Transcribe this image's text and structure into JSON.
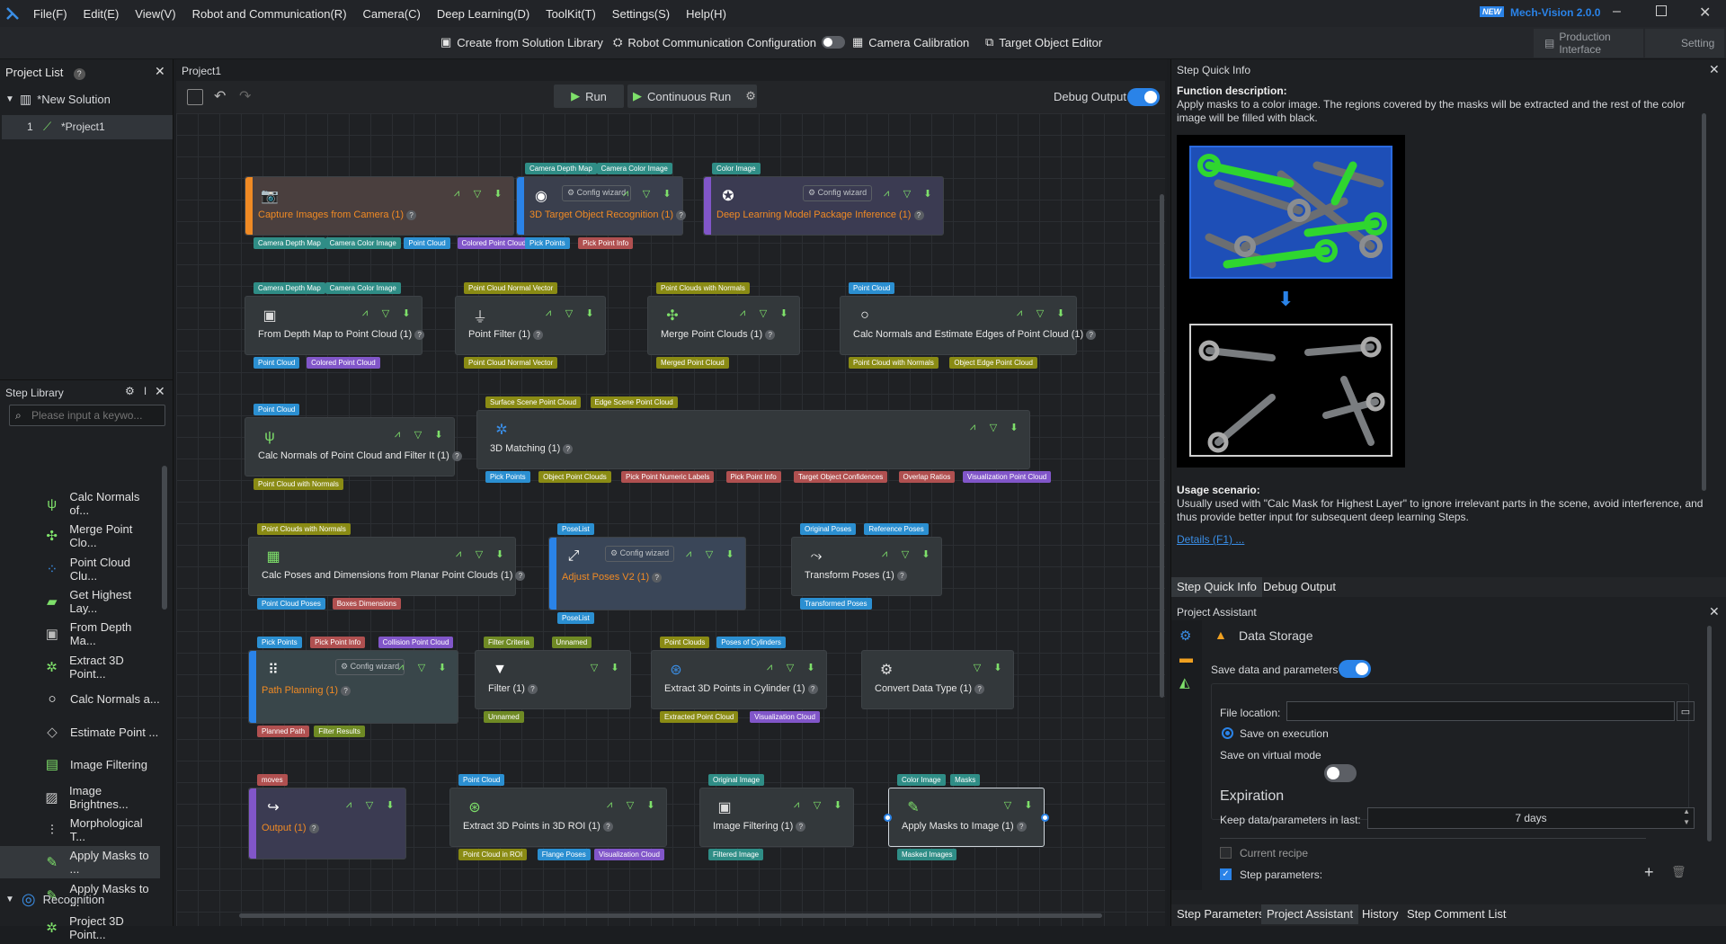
{
  "menu": [
    "File(F)",
    "Edit(E)",
    "View(V)",
    "Robot and Communication(R)",
    "Camera(C)",
    "Deep Learning(D)",
    "ToolKit(T)",
    "Settings(S)",
    "Help(H)"
  ],
  "app": {
    "badge": "NEW",
    "title": "Mech-Vision 2.0.0"
  },
  "toolbar": {
    "create": "Create from Solution Library",
    "robot_comm": "Robot Communication Configuration",
    "camera_cal": "Camera Calibration",
    "target_editor": "Target Object Editor",
    "production": "Production Interface",
    "setting": "Setting"
  },
  "project_list": {
    "title": "Project List",
    "solution": "*New Solution",
    "num": "1",
    "project": "*Project1"
  },
  "step_library": {
    "title": "Step Library",
    "search_placeholder": "Please input a keywo...",
    "items": [
      "Calc Normals of...",
      "Merge Point Clo...",
      "Point Cloud Clu...",
      "Get Highest Lay...",
      "From Depth Ma...",
      "Extract 3D Point...",
      "Calc Normals a...",
      "Estimate Point ...",
      "Image Filtering",
      "Image Brightnes...",
      "Morphological T...",
      "Apply Masks to ...",
      "Apply Masks to ...",
      "Project 3D Point..."
    ],
    "group": "Recognition"
  },
  "canvas": {
    "tab": "Project1",
    "run": "Run",
    "continuous_run": "Continuous Run",
    "debug_output": "Debug Output",
    "config_wizard": "Config wizard"
  },
  "nodes": {
    "n1": {
      "title": "Capture Images from Camera (1)",
      "out": [
        "Camera Depth Map",
        "Camera Color Image",
        "Point Cloud",
        "Colored Point Cloud"
      ]
    },
    "n2": {
      "title": "3D Target Object Recognition (1)",
      "in": [
        "Camera Depth Map",
        "Camera Color Image"
      ],
      "out": [
        "Pick Points",
        "Pick Point Info"
      ]
    },
    "n3": {
      "title": "Deep Learning Model Package Inference (1)",
      "in": [
        "Color Image"
      ]
    },
    "n4": {
      "title": "From Depth Map to Point Cloud (1)",
      "in": [
        "Camera Depth Map",
        "Camera Color Image"
      ],
      "out": [
        "Point Cloud",
        "Colored Point Cloud"
      ]
    },
    "n5": {
      "title": "Point Filter (1)",
      "in": [
        "Point Cloud Normal Vector"
      ],
      "out": [
        "Point Cloud Normal Vector"
      ]
    },
    "n6": {
      "title": "Merge Point Clouds (1)",
      "in": [
        "Point Clouds with Normals"
      ],
      "out": [
        "Merged Point Cloud"
      ]
    },
    "n7": {
      "title": "Calc Normals and Estimate Edges of Point Cloud (1)",
      "in": [
        "Point Cloud"
      ],
      "out": [
        "Point Cloud with Normals",
        "Object Edge Point Cloud"
      ]
    },
    "n8": {
      "title": "Calc Normals of Point Cloud and Filter It (1)",
      "in": [
        "Point Cloud"
      ],
      "out": [
        "Point Cloud with Normals"
      ]
    },
    "n9": {
      "title": "3D Matching (1)",
      "in": [
        "Surface Scene Point Cloud",
        "Edge Scene Point Cloud"
      ],
      "out": [
        "Pick Points",
        "Object Point Clouds",
        "Pick Point Numeric Labels",
        "Pick Point Info",
        "Target Object Confidences",
        "Overlap Ratios",
        "Visualization Point Cloud"
      ]
    },
    "n10": {
      "title": "Calc Poses and Dimensions from Planar Point Clouds (1)",
      "in": [
        "Point Clouds with Normals"
      ],
      "out": [
        "Point Cloud Poses",
        "Boxes Dimensions"
      ]
    },
    "n11": {
      "title": "Adjust Poses V2 (1)",
      "in": [
        "PoseList"
      ],
      "out": [
        "PoseList"
      ]
    },
    "n12": {
      "title": "Transform Poses (1)",
      "in": [
        "Original Poses",
        "Reference Poses"
      ],
      "out": [
        "Transformed Poses"
      ]
    },
    "n13": {
      "title": "Path Planning (1)",
      "in": [
        "Pick Points",
        "Pick Point Info",
        "Collision Point Cloud"
      ],
      "out": [
        "Planned Path",
        "Filter Results"
      ]
    },
    "n14": {
      "title": "Filter (1)",
      "in": [
        "Filter Criteria",
        "Unnamed"
      ],
      "out": [
        "Unnamed"
      ]
    },
    "n15": {
      "title": "Extract 3D Points in Cylinder (1)",
      "in": [
        "Point Clouds",
        "Poses of Cylinders"
      ],
      "out": [
        "Extracted Point Cloud",
        "Visualization Cloud"
      ]
    },
    "n16": {
      "title": "Convert Data Type (1)"
    },
    "n17": {
      "title": "Output (1)",
      "in": [
        "moves"
      ]
    },
    "n18": {
      "title": "Extract 3D Points in 3D ROI (1)",
      "in": [
        "Point Cloud"
      ],
      "out": [
        "Point Cloud in ROI",
        "Flange Poses",
        "Visualization Cloud"
      ]
    },
    "n19": {
      "title": "Image Filtering (1)",
      "in": [
        "Original Image"
      ],
      "out": [
        "Filtered Image"
      ]
    },
    "n20": {
      "title": "Apply Masks to Image (1)",
      "in": [
        "Color Image",
        "Masks"
      ],
      "out": [
        "Masked Images"
      ]
    }
  },
  "quick_info": {
    "title": "Step Quick Info",
    "func_label": "Function description:",
    "func_text": "Apply masks to a color image. The regions covered by the masks will be extracted and the rest of the color image will be filled with black.",
    "usage_label": "Usage scenario:",
    "usage_text": "Usually used with \"Calc Mask for Highest Layer\" to ignore irrelevant parts in the scene, avoid interference, and thus provide better input for subsequent deep learning Steps.",
    "details": "Details (F1) ...",
    "tabs": [
      "Step Quick Info",
      "Debug Output"
    ]
  },
  "assistant": {
    "title": "Project Assistant",
    "section": "Data Storage",
    "save_data": "Save data and parameters",
    "file_location": "File location:",
    "save_on_execution": "Save on execution",
    "save_virtual": "Save on virtual mode",
    "expiration": "Expiration",
    "keep_label": "Keep data/parameters in last:",
    "keep_value": "7 days",
    "current_recipe": "Current recipe",
    "step_params": "Step parameters:"
  },
  "bottom_tabs": [
    "Step Parameters",
    "Project Assistant",
    "History",
    "Step Comment List"
  ],
  "colors": {
    "accent": "#2a83e8",
    "node_green": "#7ee06a",
    "orange": "#f08a24"
  }
}
